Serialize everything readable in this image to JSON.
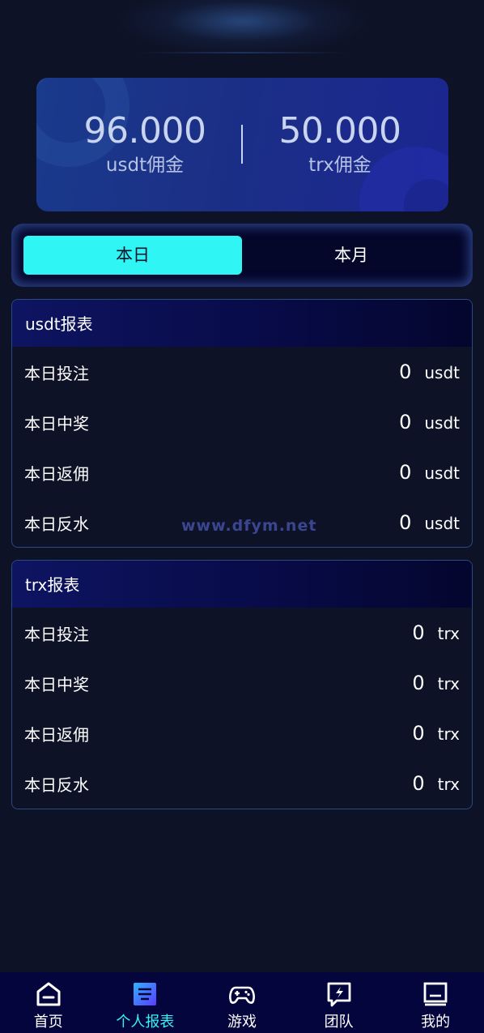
{
  "balances": {
    "usdt": {
      "value": "96.000",
      "label": "usdt佣金"
    },
    "trx": {
      "value": "50.000",
      "label": "trx佣金"
    }
  },
  "tabs": [
    {
      "label": "本日",
      "active": true
    },
    {
      "label": "本月",
      "active": false
    }
  ],
  "usdt_report": {
    "title": "usdt报表",
    "unit": "usdt",
    "rows": [
      {
        "label": "本日投注",
        "value": "0"
      },
      {
        "label": "本日中奖",
        "value": "0"
      },
      {
        "label": "本日返佣",
        "value": "0"
      },
      {
        "label": "本日反水",
        "value": "0"
      }
    ]
  },
  "trx_report": {
    "title": "trx报表",
    "unit": "trx",
    "rows": [
      {
        "label": "本日投注",
        "value": "0"
      },
      {
        "label": "本日中奖",
        "value": "0"
      },
      {
        "label": "本日返佣",
        "value": "0"
      },
      {
        "label": "本日反水",
        "value": "0"
      }
    ]
  },
  "watermark": "www.dfym.net",
  "nav": [
    {
      "label": "首页",
      "icon": "home-icon",
      "active": false
    },
    {
      "label": "个人报表",
      "icon": "report-icon",
      "active": true
    },
    {
      "label": "游戏",
      "icon": "gamepad-icon",
      "active": false
    },
    {
      "label": "团队",
      "icon": "team-icon",
      "active": false
    },
    {
      "label": "我的",
      "icon": "profile-icon",
      "active": false
    }
  ],
  "colors": {
    "accent": "#2ff6f4",
    "background": "#0d1226",
    "card": "#1b2f86",
    "nav_background": "#04053c"
  }
}
